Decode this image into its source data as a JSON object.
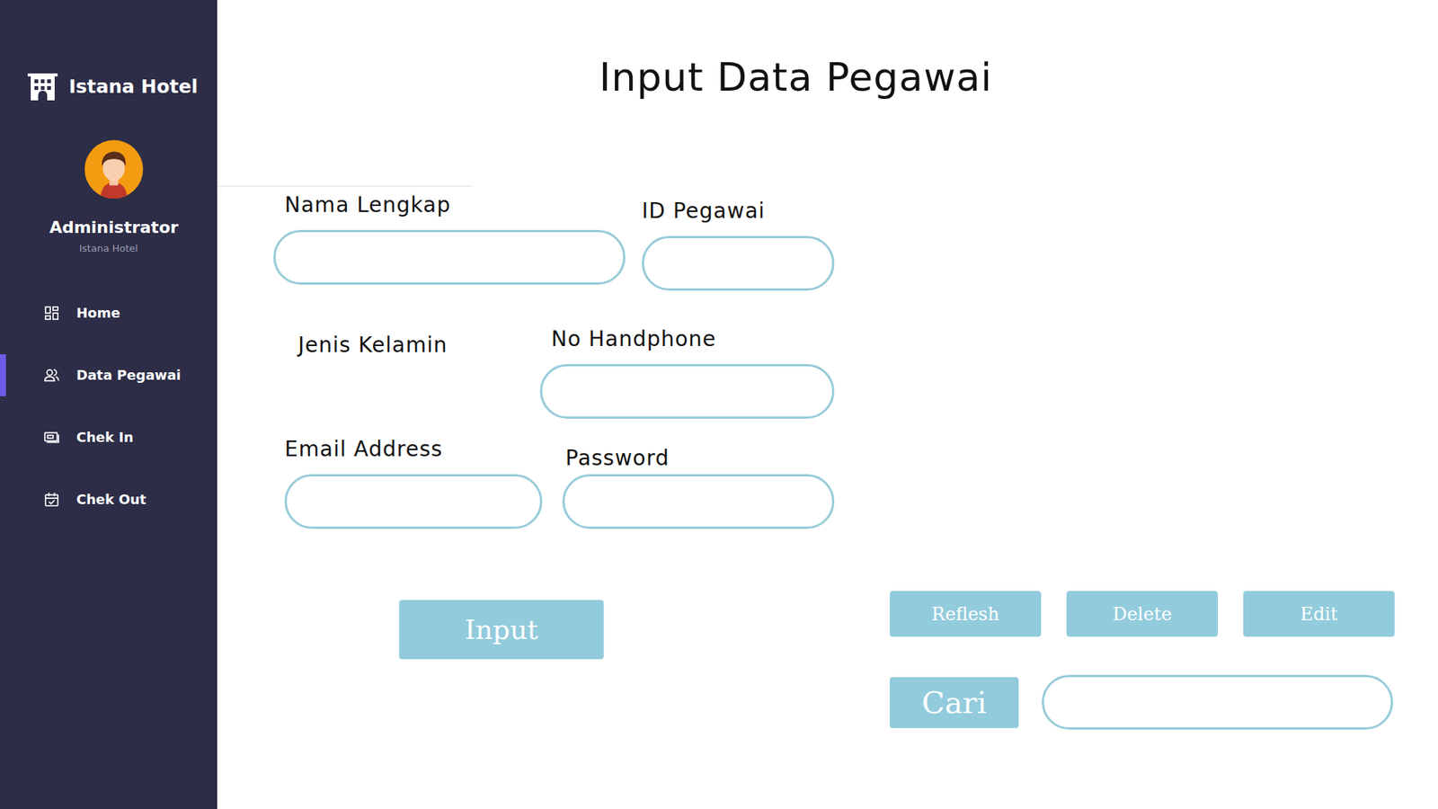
{
  "sidebar": {
    "brand": "Istana Hotel",
    "user": {
      "name": "Administrator",
      "subtitle": "Istana Hotel"
    },
    "items": [
      {
        "label": "Home",
        "selected": false
      },
      {
        "label": "Data Pegawai",
        "selected": true
      },
      {
        "label": "Chek In",
        "selected": false
      },
      {
        "label": "Chek Out",
        "selected": false
      }
    ]
  },
  "page": {
    "title": "Input Data Pegawai"
  },
  "form": {
    "fields": [
      {
        "label": "Nama Lengkap",
        "kind": "input"
      },
      {
        "label": "ID Pegawai",
        "kind": "input"
      },
      {
        "label": "Jenis Kelamin",
        "kind": "label"
      },
      {
        "label": "No Handphone",
        "kind": "input"
      },
      {
        "label": "Email Address",
        "kind": "input"
      },
      {
        "label": "Password",
        "kind": "input"
      }
    ],
    "submit": "Input"
  },
  "actions": [
    "Reflesh",
    "Delete",
    "Edit"
  ],
  "search": {
    "button": "Cari"
  }
}
